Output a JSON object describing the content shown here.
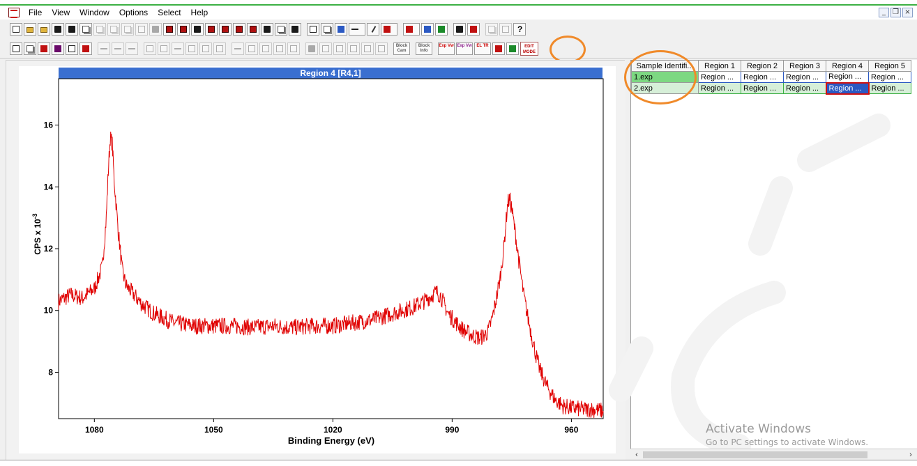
{
  "menubar": {
    "items": [
      "File",
      "View",
      "Window",
      "Options",
      "Select",
      "Help"
    ]
  },
  "toolbar": {
    "text_buttons": [
      "Block Cam",
      "Block Info",
      "Exp Vw",
      "Exp Vw",
      "EL TR"
    ],
    "edit_mode_label": "EDIT MODE",
    "help_label": "?"
  },
  "chart_data": {
    "type": "line",
    "title": "Region 4 [R4,1]",
    "xlabel": "Binding Energy (eV)",
    "ylabel": "CPS x 10",
    "ylabel_superscript": "-3",
    "x_reversed": true,
    "xlim": [
      1089,
      952
    ],
    "ylim": [
      6.5,
      17.5
    ],
    "x_ticks": [
      1080,
      1050,
      1020,
      990,
      960
    ],
    "y_ticks": [
      8,
      10,
      12,
      14,
      16
    ],
    "grid": false,
    "series": [
      {
        "color": "#e00000",
        "x": [
          1089,
          1086,
          1083,
          1080,
          1078,
          1077,
          1076.5,
          1076,
          1075.5,
          1075,
          1074,
          1073,
          1072,
          1070,
          1068,
          1065,
          1060,
          1055,
          1050,
          1045,
          1040,
          1035,
          1030,
          1025,
          1020,
          1015,
          1010,
          1005,
          1000,
          997,
          995,
          994,
          993,
          992,
          991,
          989,
          987,
          985,
          983,
          981,
          980,
          979,
          978,
          977,
          976.5,
          976,
          975.5,
          975,
          974,
          973,
          972,
          971,
          970,
          969,
          968,
          966,
          964,
          962,
          960,
          957,
          955,
          952
        ],
        "y": [
          10.3,
          10.5,
          10.4,
          10.7,
          11.4,
          13.0,
          14.5,
          15.6,
          15.4,
          14.2,
          12.6,
          11.3,
          10.8,
          10.5,
          10.2,
          9.9,
          9.6,
          9.5,
          9.5,
          9.5,
          9.45,
          9.5,
          9.45,
          9.5,
          9.5,
          9.6,
          9.7,
          9.9,
          10.1,
          10.3,
          10.5,
          10.6,
          10.5,
          10.2,
          9.9,
          9.6,
          9.35,
          9.2,
          9.1,
          9.3,
          9.7,
          10.3,
          11.0,
          12.0,
          12.8,
          13.5,
          13.6,
          13.3,
          12.4,
          11.4,
          10.5,
          9.8,
          9.2,
          8.6,
          8.1,
          7.5,
          7.1,
          6.9,
          6.85,
          6.8,
          6.8,
          6.75
        ]
      }
    ]
  },
  "grid_table": {
    "headers": [
      "Sample Identifi...",
      "Region 1",
      "Region 2",
      "Region 3",
      "Region 4",
      "Region 5"
    ],
    "rows": [
      [
        "1.exp",
        "Region ...",
        "Region ...",
        "Region ...",
        "Region ...",
        "Region ..."
      ],
      [
        "2.exp",
        "Region ...",
        "Region ...",
        "Region ...",
        "Region ...",
        "Region ..."
      ]
    ]
  },
  "activation": {
    "line1": "Activate Windows",
    "line2": "Go to PC settings to activate Windows."
  },
  "colors": {
    "title_bar": "#3a6fd0",
    "highlight_circle": "#f08a2a",
    "spectrum": "#e00000"
  }
}
